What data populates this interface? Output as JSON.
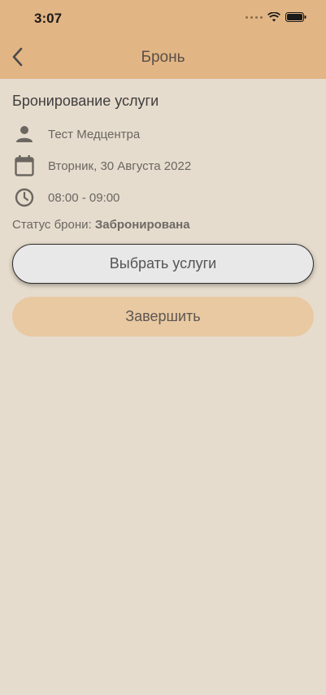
{
  "status_bar": {
    "time": "3:07"
  },
  "nav": {
    "title": "Бронь"
  },
  "booking": {
    "section_title": "Бронирование услуги",
    "clinic": "Тест Медцентра",
    "date": "Вторник, 30 Августа 2022",
    "time_range": "08:00 - 09:00",
    "status_label": "Статус брони:",
    "status_value": "Забронирована"
  },
  "actions": {
    "select_services": "Выбрать услуги",
    "finish": "Завершить"
  },
  "colors": {
    "header": "#e2b584",
    "background": "#e6dccd",
    "secondary_button": "#e8c9a2",
    "primary_button": "#e8e8e8"
  }
}
